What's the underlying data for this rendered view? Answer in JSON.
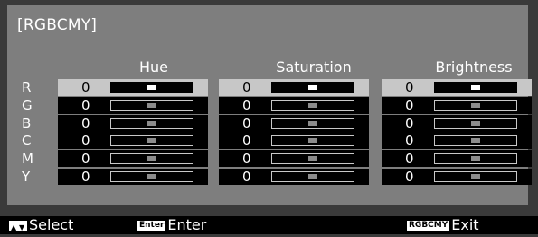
{
  "menu": {
    "title": "[RGBCMY]",
    "columns": [
      "Hue",
      "Saturation",
      "Brightness"
    ],
    "rows": [
      {
        "label": "R",
        "values": [
          "0",
          "0",
          "0"
        ]
      },
      {
        "label": "G",
        "values": [
          "0",
          "0",
          "0"
        ]
      },
      {
        "label": "B",
        "values": [
          "0",
          "0",
          "0"
        ]
      },
      {
        "label": "C",
        "values": [
          "0",
          "0",
          "0"
        ]
      },
      {
        "label": "M",
        "values": [
          "0",
          "0",
          "0"
        ]
      },
      {
        "label": "Y",
        "values": [
          "0",
          "0",
          "0"
        ]
      }
    ],
    "slider_position": 0.5,
    "selected_row": "R"
  },
  "footer": {
    "select_label": "Select",
    "enter_key": "Enter",
    "enter_label": "Enter",
    "exit_key": "RGBCMY",
    "exit_label": "Exit",
    "select_icon": "up-down-arrows-icon"
  },
  "colors": {
    "panel_bg": "#7e7e7e",
    "selected_bg": "#c7c7c7",
    "cell_bg": "#000000"
  }
}
